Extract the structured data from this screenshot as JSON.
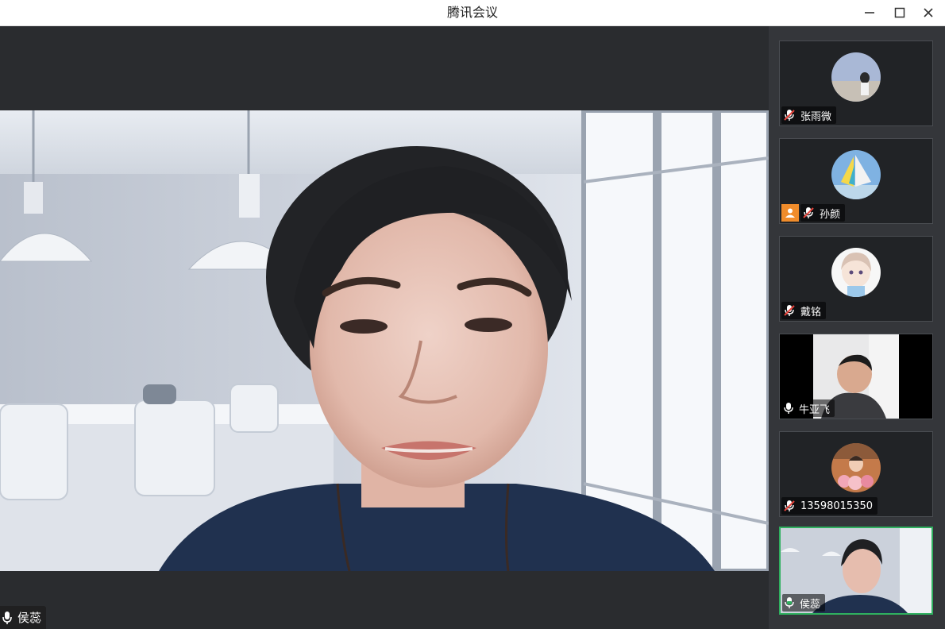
{
  "window": {
    "title": "腾讯会议",
    "controls": [
      "minimize-icon",
      "maximize-icon",
      "close-icon"
    ]
  },
  "main_speaker": {
    "name": "侯蕊",
    "mic": "on"
  },
  "participants": [
    {
      "name": "张雨微",
      "mic": "muted",
      "avatar": "girl-photo"
    },
    {
      "name": "孙颜",
      "mic": "muted",
      "avatar": "sailboat-photo",
      "host_badge": true
    },
    {
      "name": "戴铭",
      "mic": "muted",
      "avatar": "anime-girl"
    },
    {
      "name": "牛亚飞",
      "mic": "on",
      "video": true
    },
    {
      "name": "13598015350",
      "mic": "muted",
      "avatar": "child-photo"
    },
    {
      "name": "侯蕊",
      "mic": "on",
      "video": true,
      "active": true
    }
  ],
  "colors": {
    "active_border": "#2fb05f",
    "muted_icon": "#e8433b",
    "mic_on": "#ffffff",
    "host_badge": "#f08c2b"
  }
}
